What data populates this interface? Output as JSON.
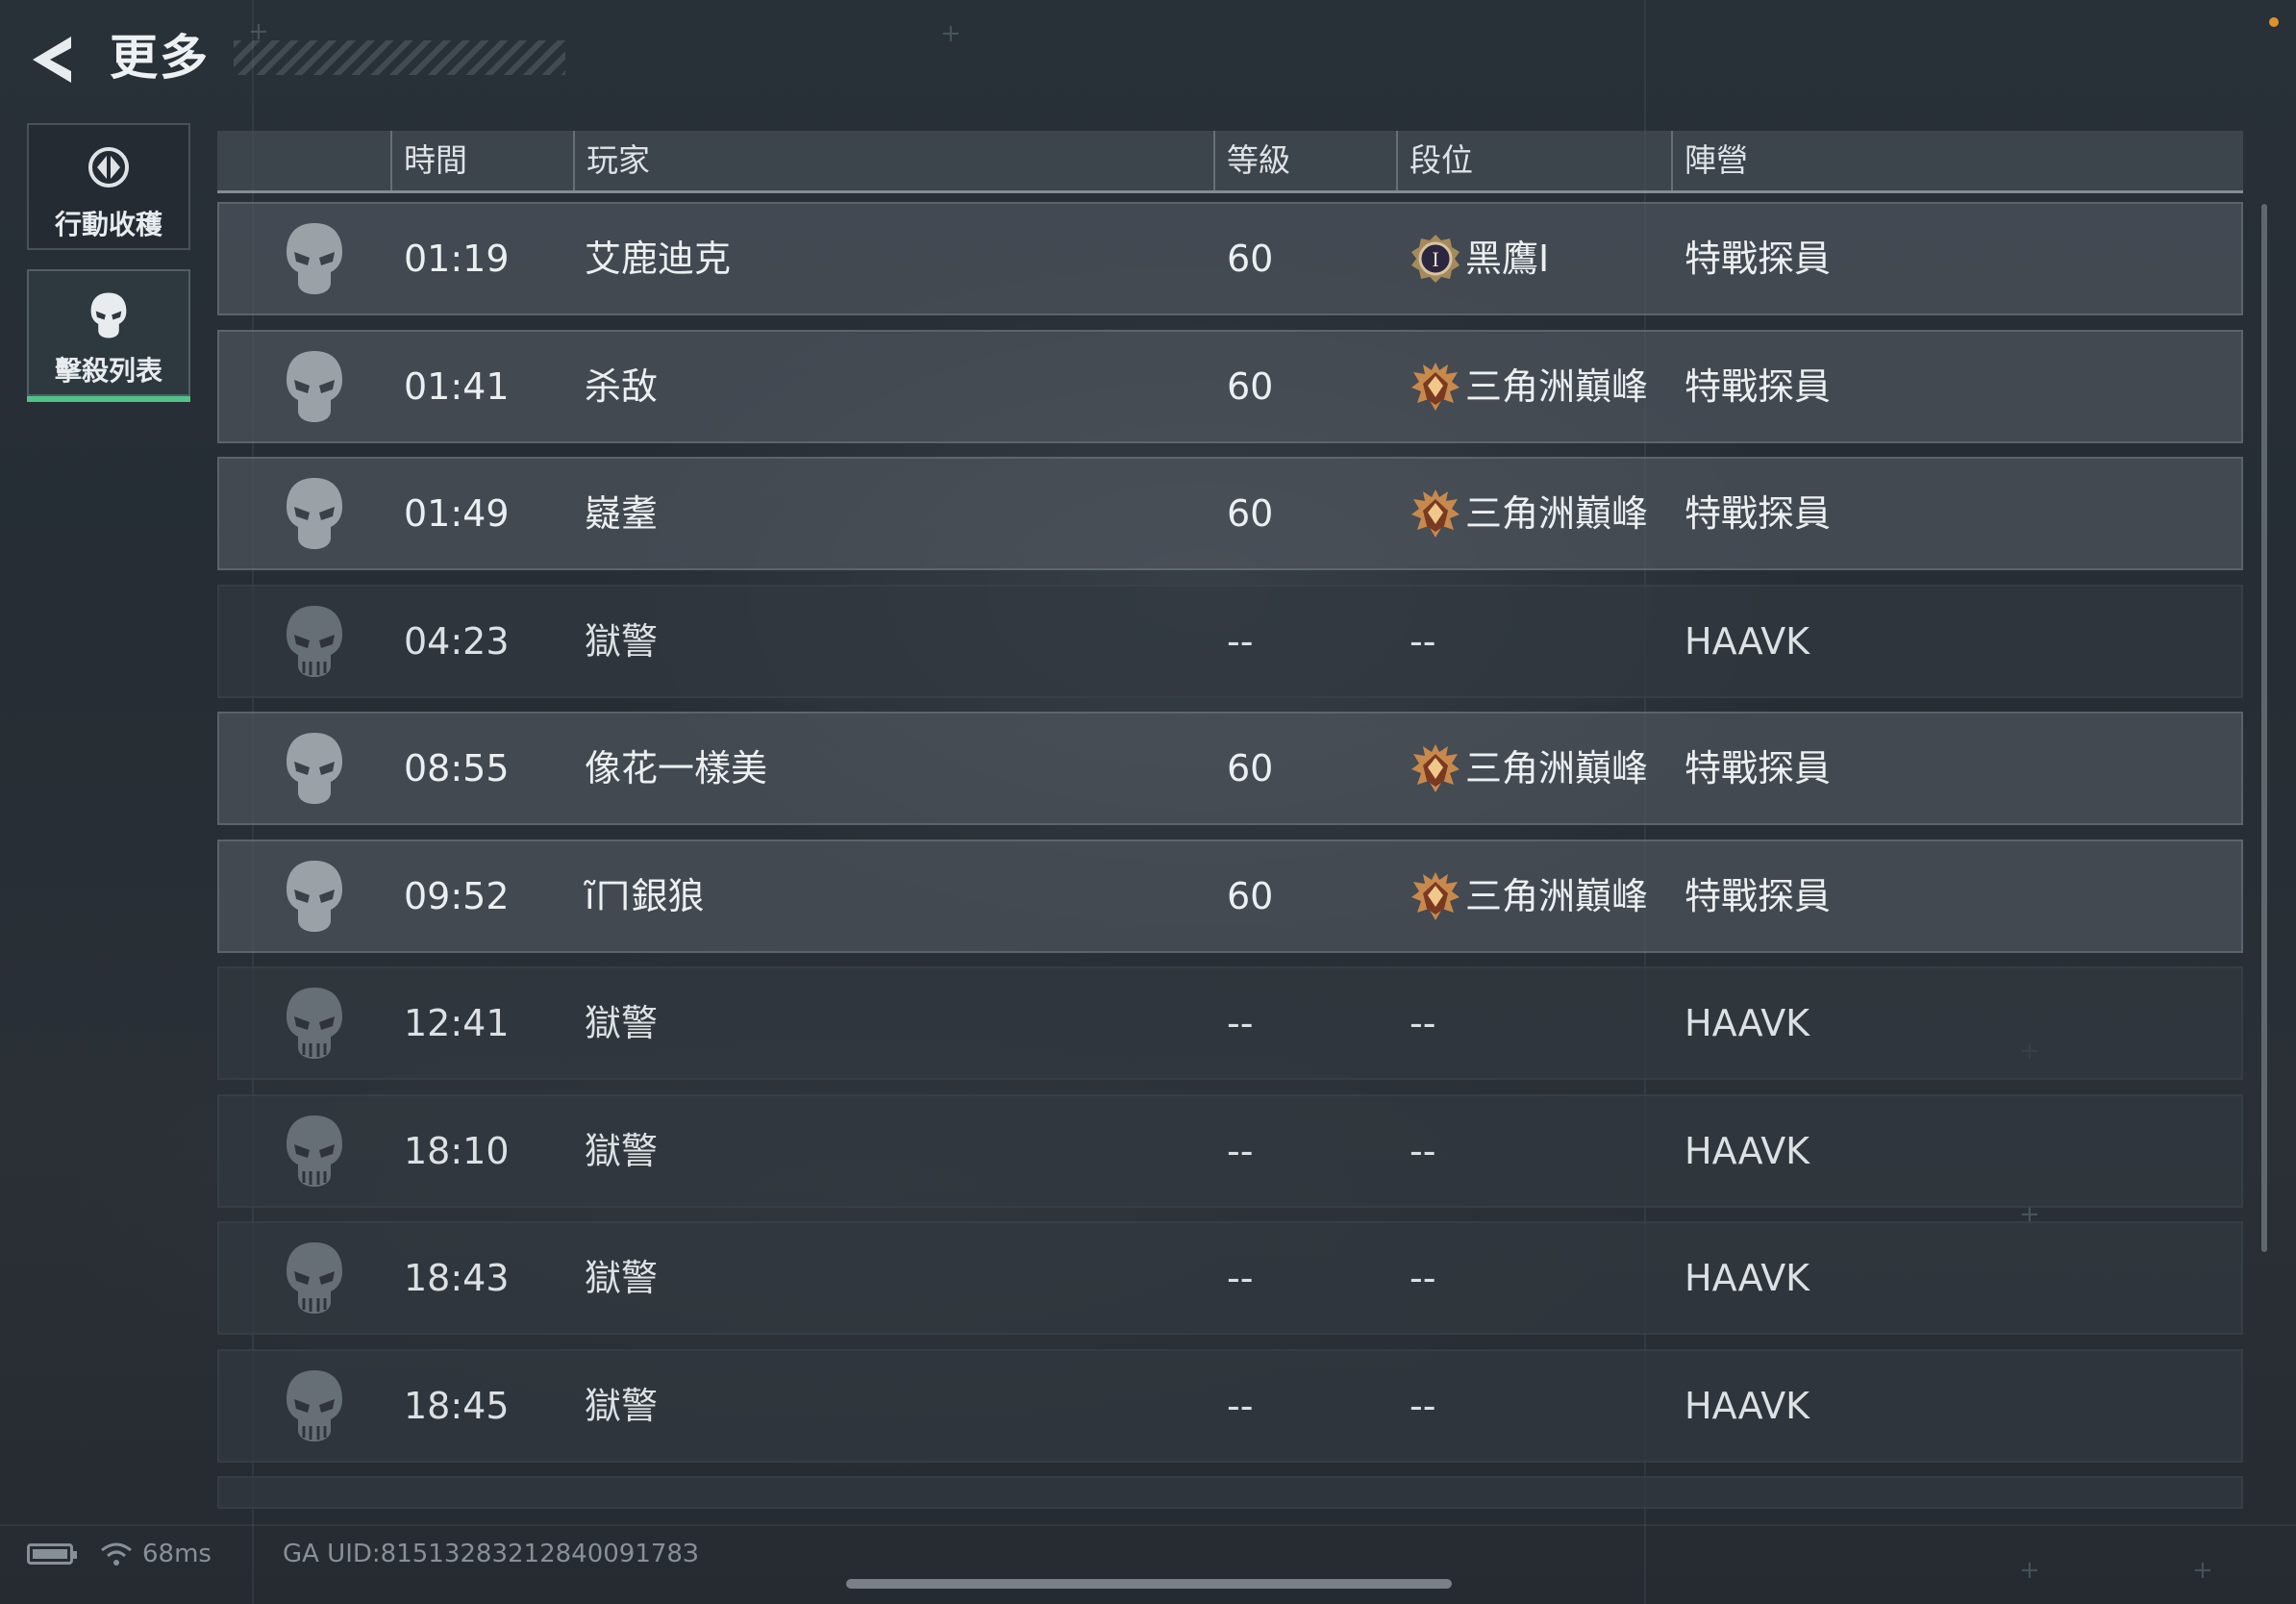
{
  "header": {
    "title": "更多"
  },
  "sidebar": {
    "tabs": [
      {
        "label": "行動收穫",
        "icon": "circle-emblem-icon",
        "active": false
      },
      {
        "label": "擊殺列表",
        "icon": "skull-icon",
        "active": true
      }
    ]
  },
  "table": {
    "columns": [
      "時間",
      "玩家",
      "等級",
      "段位",
      "陣營"
    ],
    "rows": [
      {
        "type": "player",
        "time": "01:19",
        "player": "艾鹿迪克",
        "level": "60",
        "rank": "黑鷹I",
        "rank_icon": "black-hawk-rank-icon",
        "faction": "特戰探員"
      },
      {
        "type": "player",
        "time": "01:41",
        "player": "杀敌",
        "level": "60",
        "rank": "三角洲巔峰",
        "rank_icon": "delta-peak-rank-icon",
        "faction": "特戰探員"
      },
      {
        "type": "player",
        "time": "01:49",
        "player": "嶷耋",
        "level": "60",
        "rank": "三角洲巔峰",
        "rank_icon": "delta-peak-rank-icon",
        "faction": "特戰探員"
      },
      {
        "type": "npc",
        "time": "04:23",
        "player": "獄警",
        "level": "--",
        "rank": "--",
        "rank_icon": "",
        "faction": "HAAVK"
      },
      {
        "type": "player",
        "time": "08:55",
        "player": "像花一樣美",
        "level": "60",
        "rank": "三角洲巔峰",
        "rank_icon": "delta-peak-rank-icon",
        "faction": "特戰探員"
      },
      {
        "type": "player",
        "time": "09:52",
        "player": "ĩㄇ銀狼",
        "level": "60",
        "rank": "三角洲巔峰",
        "rank_icon": "delta-peak-rank-icon",
        "faction": "特戰探員"
      },
      {
        "type": "npc",
        "time": "12:41",
        "player": "獄警",
        "level": "--",
        "rank": "--",
        "rank_icon": "",
        "faction": "HAAVK"
      },
      {
        "type": "npc",
        "time": "18:10",
        "player": "獄警",
        "level": "--",
        "rank": "--",
        "rank_icon": "",
        "faction": "HAAVK"
      },
      {
        "type": "npc",
        "time": "18:43",
        "player": "獄警",
        "level": "--",
        "rank": "--",
        "rank_icon": "",
        "faction": "HAAVK"
      },
      {
        "type": "npc",
        "time": "18:45",
        "player": "獄警",
        "level": "--",
        "rank": "--",
        "rank_icon": "",
        "faction": "HAAVK"
      }
    ]
  },
  "status_bar": {
    "ping": "68ms",
    "uid": "GA UID:8151328321284009178З"
  },
  "colors": {
    "accent": "#4fc38a",
    "notification_dot": "#e0922a"
  }
}
